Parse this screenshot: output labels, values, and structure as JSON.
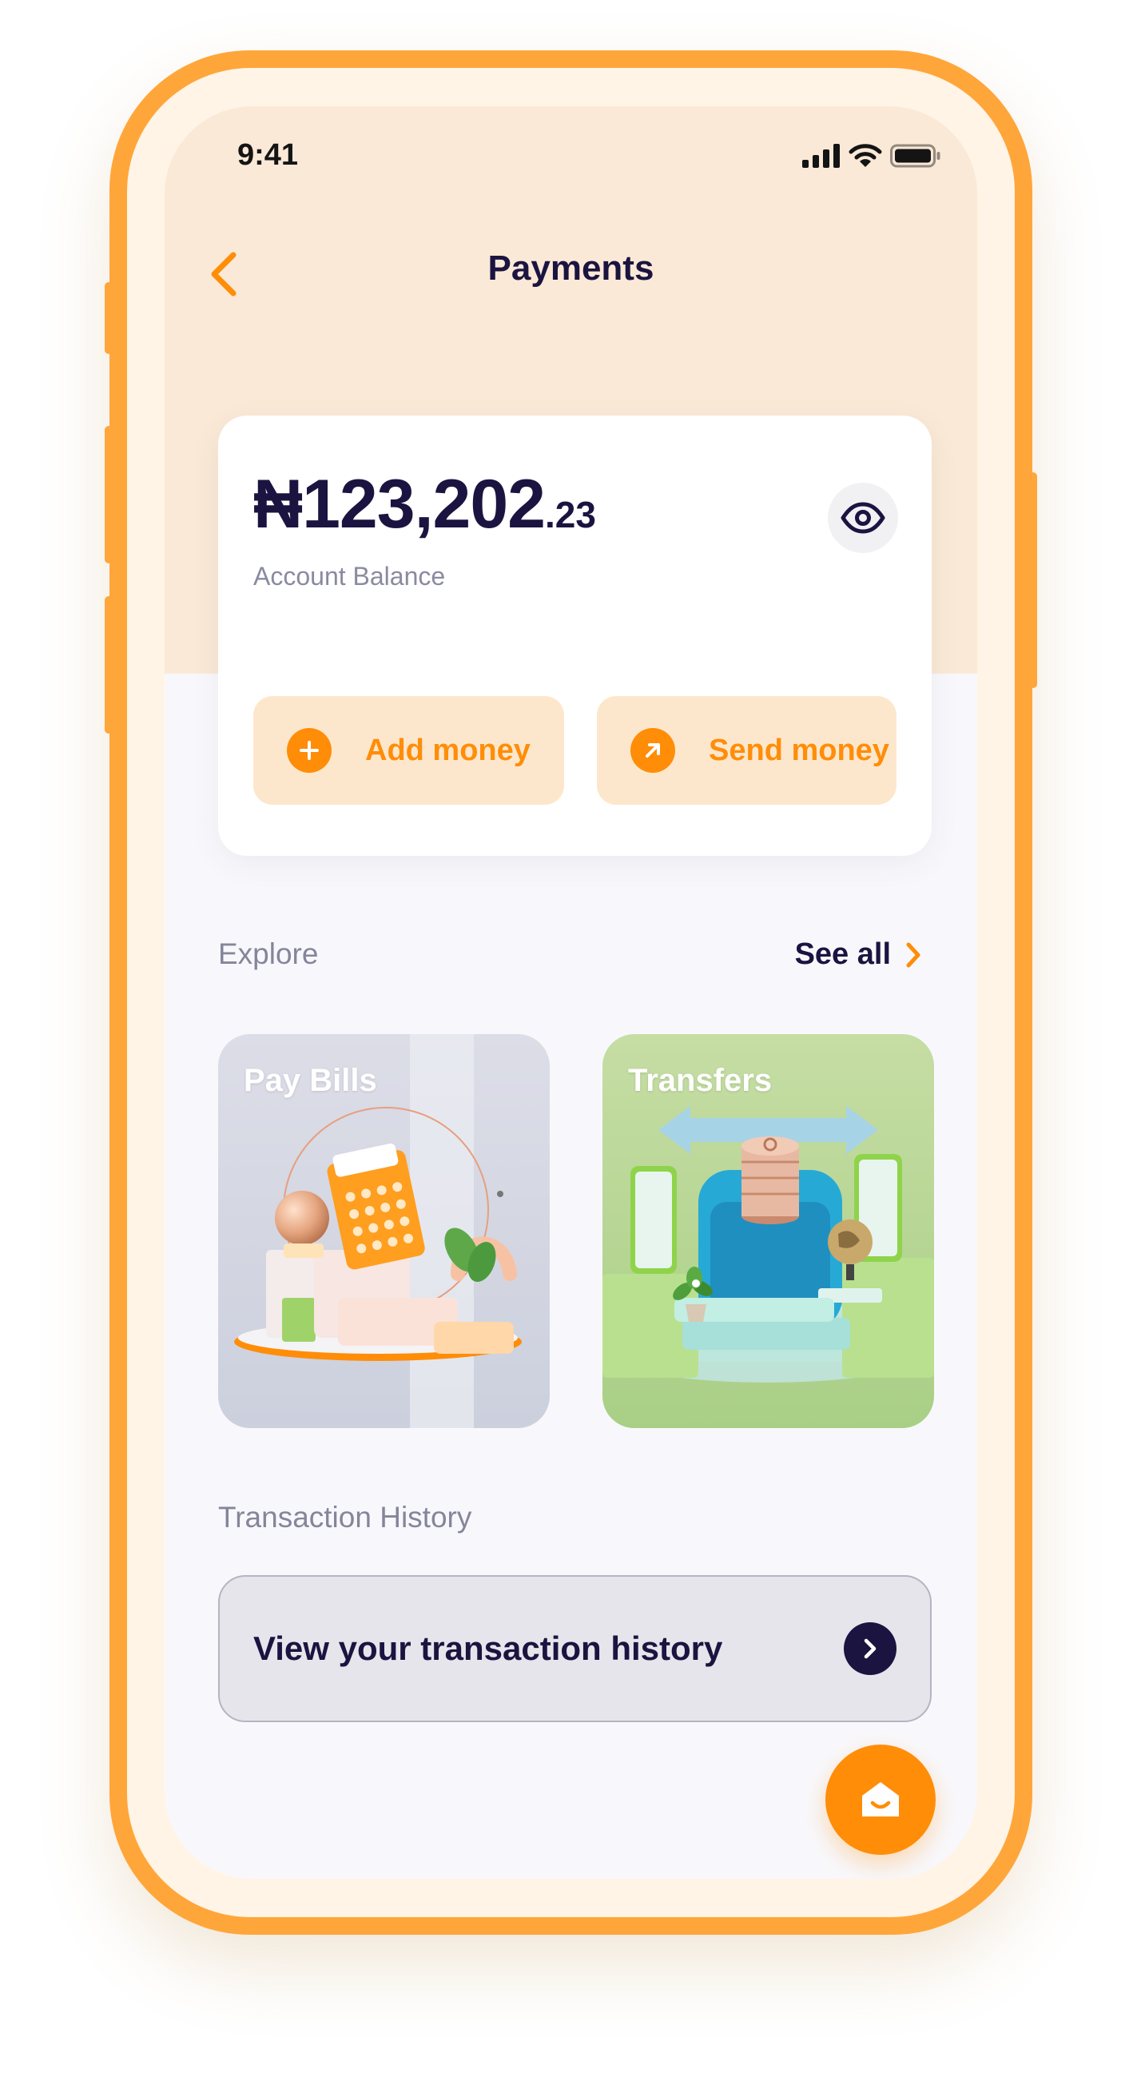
{
  "status_bar": {
    "time": "9:41"
  },
  "header": {
    "title": "Payments"
  },
  "balance": {
    "amount": "₦123,202",
    "cents": ".23",
    "label": "Account Balance"
  },
  "actions": {
    "add_money": "Add money",
    "send_money": "Send money"
  },
  "explore": {
    "label": "Explore",
    "see_all": "See all",
    "tiles": [
      {
        "title": "Pay Bills"
      },
      {
        "title": "Transfers"
      }
    ]
  },
  "history": {
    "label": "Transaction History",
    "cta": "View your transaction history"
  },
  "colors": {
    "accent": "#ff8d08",
    "navy": "#1b1440",
    "frame": "#ffa63a",
    "header_bg": "#fbe9d7"
  }
}
